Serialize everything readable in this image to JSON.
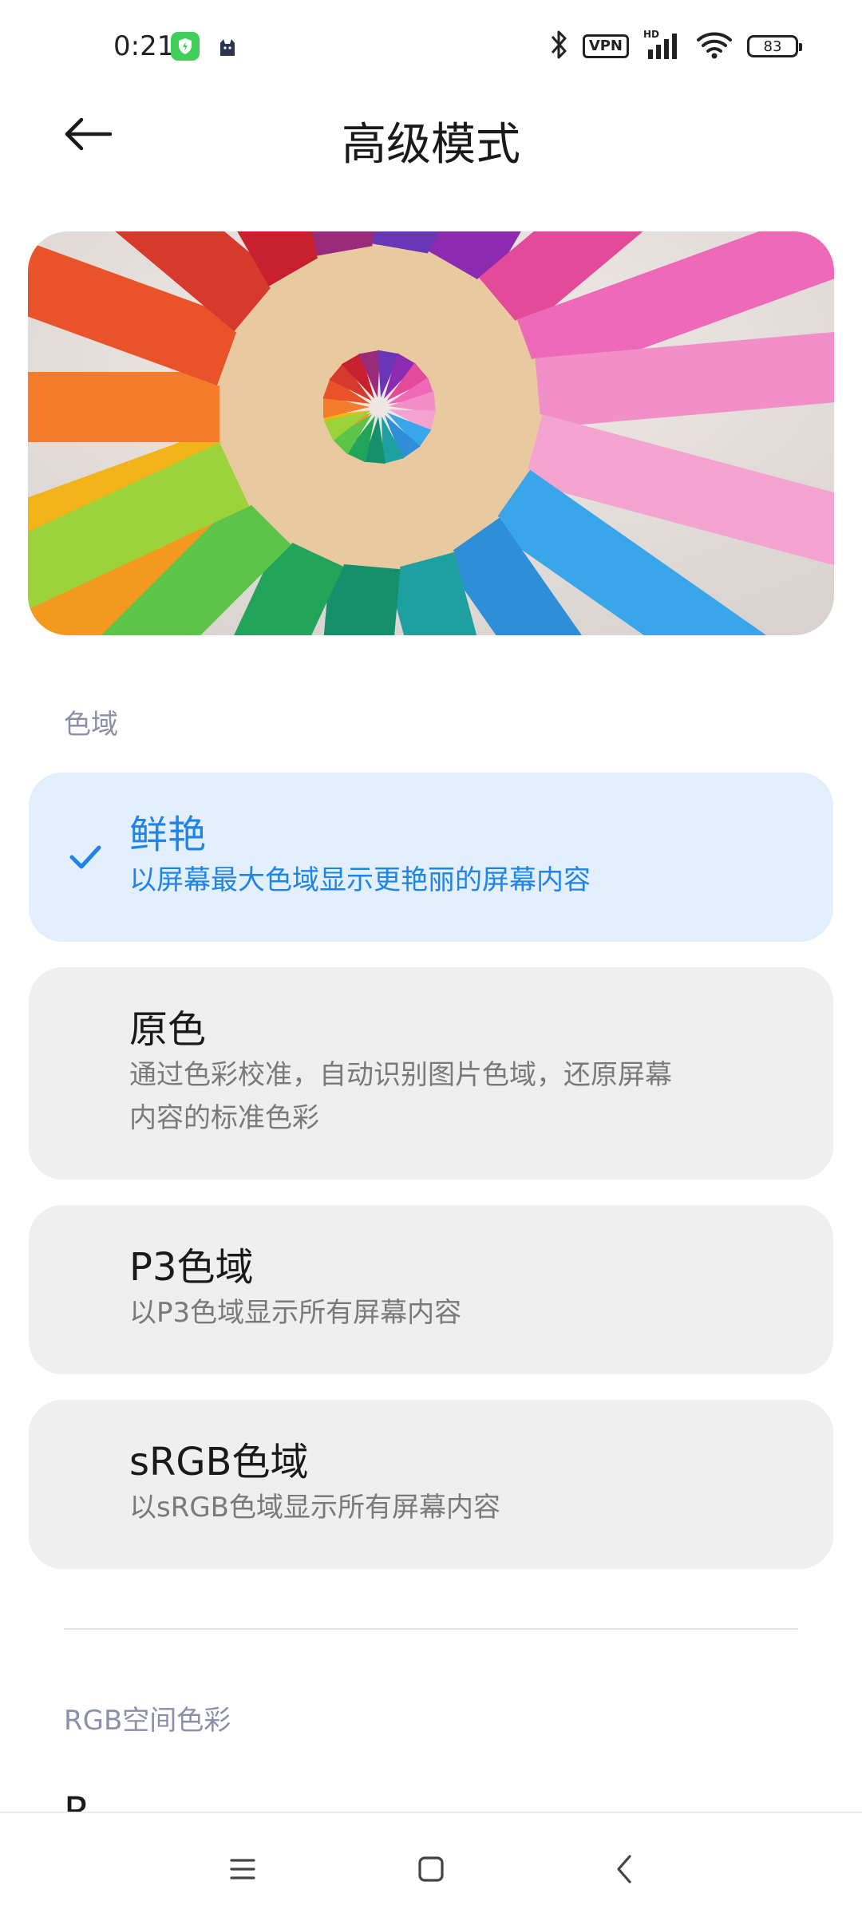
{
  "status_bar": {
    "time": "0:21",
    "vpn_label": "VPN",
    "battery_level": "83",
    "icons": [
      "shield-app-icon",
      "cat-app-icon",
      "bluetooth-icon",
      "vpn-icon",
      "signal-hd-icon",
      "wifi-icon",
      "battery-icon"
    ]
  },
  "header": {
    "title": "高级模式",
    "back_icon": "arrow-left-icon"
  },
  "hero": {
    "image": "colored-pencils-photo"
  },
  "gamut_section": {
    "header": "色域",
    "options": [
      {
        "title": "鲜艳",
        "desc": "以屏幕最大色域显示更艳丽的屏幕内容",
        "selected": true
      },
      {
        "title": "原色",
        "desc_line1": "通过色彩校准，自动识别图片色域，还原屏幕",
        "desc_line2": "内容的标准色彩",
        "selected": false
      },
      {
        "title": "P3色域",
        "desc": "以P3色域显示所有屏幕内容",
        "selected": false
      },
      {
        "title": "sRGB色域",
        "desc": "以sRGB色域显示所有屏幕内容",
        "selected": false
      }
    ]
  },
  "rgb_section": {
    "header": "RGB空间色彩",
    "first_item_label": "R"
  },
  "nav_bar": {
    "icons": [
      "menu-icon",
      "home-icon",
      "back-chevron-icon"
    ]
  },
  "colors": {
    "accent": "#1f84e6",
    "selected_bg": "#e3effd",
    "card_bg": "#efefef",
    "section_header": "#8a90a8"
  }
}
